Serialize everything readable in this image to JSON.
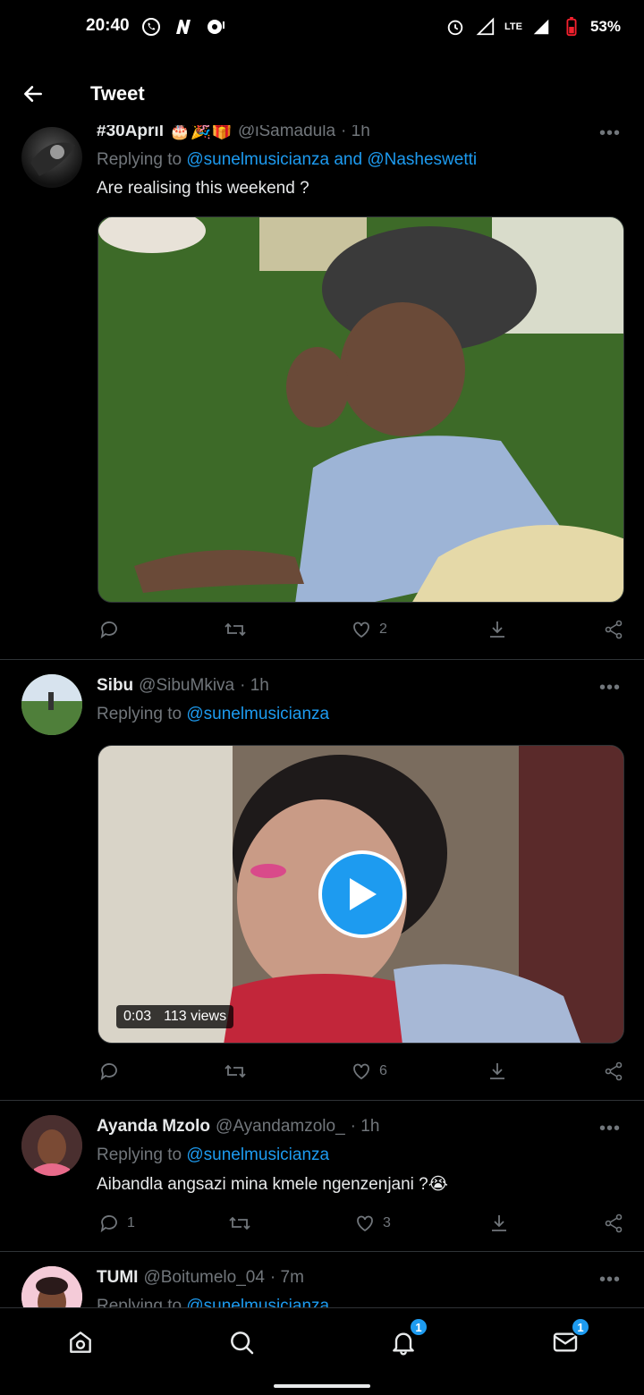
{
  "status_bar": {
    "time": "20:40",
    "battery": "53%",
    "network": "LTE"
  },
  "header": {
    "title": "Tweet"
  },
  "tweets": [
    {
      "name": "#30April",
      "handle": "@iSamadula",
      "time": "· 1h",
      "reply_prefix": "Replying to",
      "reply_to": "@sunelmusicianza and @Nasheswetti",
      "text": "Are realising this weekend ?",
      "media": "image",
      "replies": "",
      "retweets": "",
      "likes": "2"
    },
    {
      "name": "Sibu",
      "handle": "@SibuMkiva",
      "time": "· 1h",
      "reply_prefix": "Replying to",
      "reply_to": "@sunelmusicianza",
      "text": "",
      "media": "video",
      "video_time": "0:03",
      "video_views": "113 views",
      "replies": "",
      "retweets": "",
      "likes": "6"
    },
    {
      "name": "Ayanda Mzolo",
      "handle": "@Ayandamzolo_",
      "time": "· 1h",
      "reply_prefix": "Replying to",
      "reply_to": "@sunelmusicianza",
      "text": "Aibandla angsazi mina kmele ngenzenjani ?😭",
      "media": "none",
      "replies": "1",
      "retweets": "",
      "likes": "3"
    },
    {
      "name": "TUMI",
      "handle": "@Boitumelo_04",
      "time": "· 7m",
      "reply_prefix": "Replying to",
      "reply_to": "@sunelmusicianza"
    }
  ],
  "nav": {
    "notifications_badge": "1",
    "messages_badge": "1"
  },
  "colors": {
    "accent": "#1d9bf0",
    "background": "#000000",
    "muted": "#71767b"
  }
}
